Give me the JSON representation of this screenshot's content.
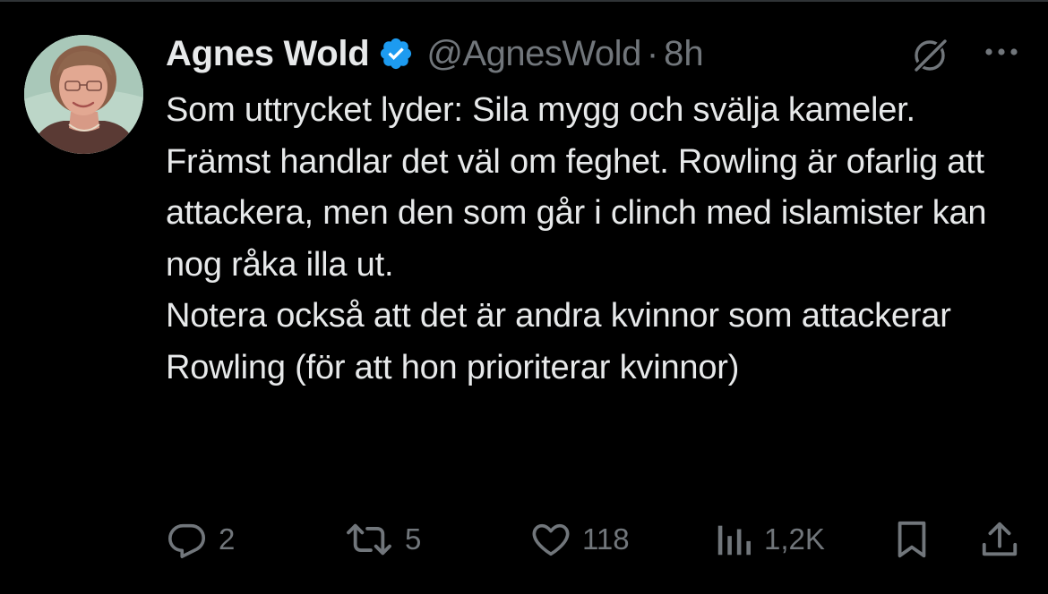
{
  "author": {
    "display_name": "Agnes Wold",
    "handle": "@AgnesWold",
    "separator": "·",
    "timestamp": "8h",
    "verified": true,
    "verified_badge_color": "#1d9bf0"
  },
  "tweet": {
    "text": "Som uttrycket lyder: Sila mygg och svälja kameler.\nFrämst handlar det väl om feghet. Rowling är ofarlig att attackera, men den som går i clinch med islamister kan nog råka illa ut.\nNotera också att det är andra kvinnor som attackerar Rowling (för att hon prioriterar kvinnor)"
  },
  "actions": {
    "replies": {
      "icon": "reply-icon",
      "count": "2"
    },
    "reposts": {
      "icon": "repost-icon",
      "count": "5"
    },
    "likes": {
      "icon": "heart-icon",
      "count": "118"
    },
    "views": {
      "icon": "views-icon",
      "count": "1,2K"
    },
    "bookmark": {
      "icon": "bookmark-icon"
    },
    "share": {
      "icon": "share-icon"
    }
  },
  "header_icons": {
    "grok": "grok-icon",
    "more": "more-icon"
  },
  "colors": {
    "background": "#000000",
    "text_primary": "#e7e9ea",
    "text_secondary": "#71767b"
  }
}
